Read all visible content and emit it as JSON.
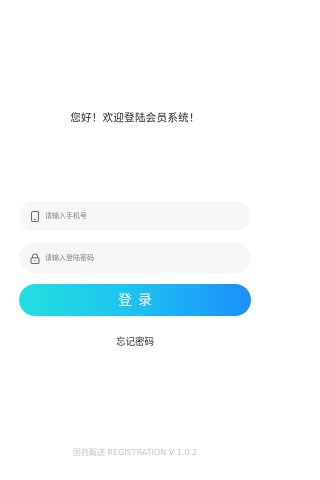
{
  "welcome_text": "您好！欢迎登陆会员系统！",
  "phone_field": {
    "icon": "phone-icon",
    "placeholder": "请输入手机号",
    "value": ""
  },
  "password_field": {
    "icon": "lock-icon",
    "placeholder": "请输入登陆密码",
    "value": ""
  },
  "login_button": {
    "label": "登录",
    "gradient_start": "#22dfe0",
    "gradient_end": "#1c8ffb"
  },
  "forgot_link": "忘记密码",
  "footer_text": "国药甄选 REGISTRATION V 1.0.2"
}
